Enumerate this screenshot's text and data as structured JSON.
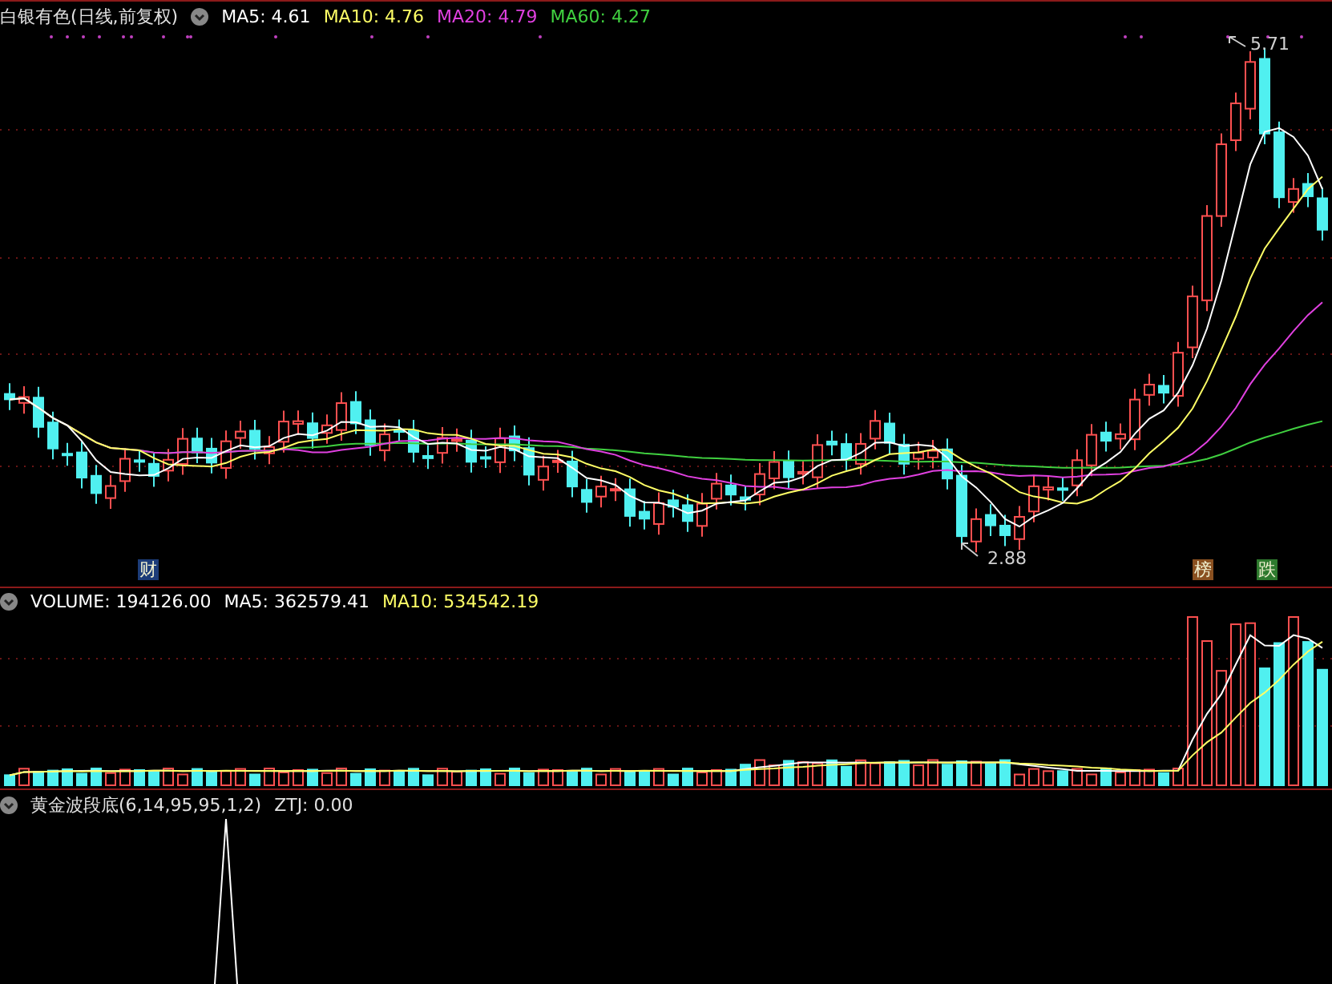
{
  "price_panel": {
    "title": "白银有色(日线,前复权)",
    "indicators": [
      {
        "label": "MA5: 4.61",
        "color": "#ffffff"
      },
      {
        "label": "MA10: 4.76",
        "color": "#ffff66"
      },
      {
        "label": "MA20: 4.79",
        "color": "#e040e0"
      },
      {
        "label": "MA60: 4.27",
        "color": "#40d040"
      }
    ],
    "high_label": "5.71",
    "low_label": "2.88",
    "markers": [
      {
        "text": "财",
        "color": "#1c3c78"
      },
      {
        "text": "榜",
        "color": "#8a5020"
      },
      {
        "text": "跌",
        "color": "#2e7a2e"
      }
    ]
  },
  "volume_panel": {
    "indicators": [
      {
        "label": "VOLUME: 194126.00",
        "color": "#ffffff"
      },
      {
        "label": "MA5: 362579.41",
        "color": "#ffffff"
      },
      {
        "label": "MA10: 534542.19",
        "color": "#ffff66"
      }
    ]
  },
  "indicator_panel": {
    "title": "黄金波段底(6,14,95,95,1,2)",
    "value": "ZTJ: 0.00"
  }
}
